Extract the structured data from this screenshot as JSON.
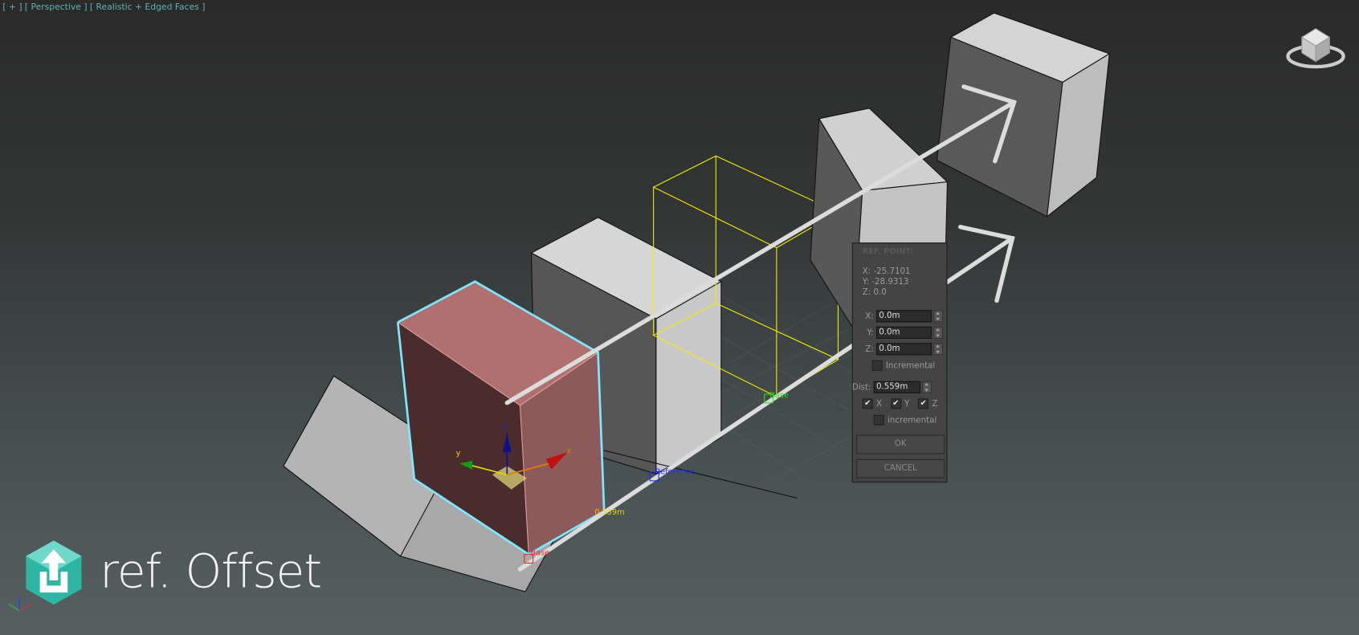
{
  "viewport": {
    "labels": [
      "[ + ]",
      "[ Perspective ]",
      "[ Realistic + Edged Faces ]"
    ]
  },
  "scene_labels": {
    "base_red": "Base",
    "reference": "Reference",
    "base_green": "Base",
    "distance": "0.559m",
    "gizmo_x": "x",
    "gizmo_y": "y",
    "gizmo_z": "z"
  },
  "dialog": {
    "title": "REF. POINT:",
    "readout": [
      "X: -25.7101",
      "Y: -28.9313",
      "Z: 0.0"
    ],
    "fields": [
      {
        "label": "X:",
        "value": "0.0m"
      },
      {
        "label": "Y:",
        "value": "0.0m"
      },
      {
        "label": "Z:",
        "value": "0.0m"
      }
    ],
    "incremental_1": {
      "label": "Incremental",
      "checked": false
    },
    "dist": {
      "label": "Dist:",
      "value": "0.559m"
    },
    "axes": [
      {
        "label": "X",
        "checked": true
      },
      {
        "label": "Y",
        "checked": true
      },
      {
        "label": "Z",
        "checked": true
      }
    ],
    "incremental_2": {
      "label": "incremental",
      "checked": false
    },
    "ok": "OK",
    "cancel": "CANCEL"
  },
  "branding": {
    "title": "ref. Offset",
    "accent": "#2fb5a3"
  },
  "colors": {
    "selection": "#7fe6ff",
    "selected_object": "#b07070",
    "wireframe": "#f0f000"
  }
}
